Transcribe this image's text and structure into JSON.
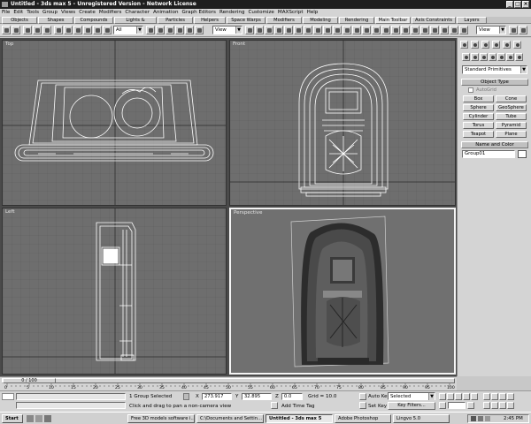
{
  "window": {
    "title": "Untitled - 3ds max 5 - Unregistered Version - Network License"
  },
  "menu": [
    "File",
    "Edit",
    "Tools",
    "Group",
    "Views",
    "Create",
    "Modifiers",
    "Character",
    "Animation",
    "Graph Editors",
    "Rendering",
    "Customize",
    "MAXScript",
    "Help"
  ],
  "tabs": [
    "Objects",
    "Shapes",
    "Compounds",
    "Lights & Cameras",
    "Particles",
    "Helpers",
    "Space Warps",
    "Modifiers",
    "Modeling",
    "Rendering",
    "Main Toolbar",
    "Axis Constraints",
    "Layers"
  ],
  "active_tab": "Main Toolbar",
  "toolbar": {
    "selection_filter": "All",
    "ref_coord": "View",
    "named_selection": "View"
  },
  "viewports": {
    "top": "Top",
    "front": "Front",
    "left": "Left",
    "perspective": "Perspective"
  },
  "command_panel": {
    "category": "Standard Primitives",
    "object_type_header": "Object Type",
    "autogrid": "AutoGrid",
    "buttons": [
      "Box",
      "Cone",
      "Sphere",
      "GeoSphere",
      "Cylinder",
      "Tube",
      "Torus",
      "Pyramid",
      "Teapot",
      "Plane"
    ],
    "name_color_header": "Name and Color",
    "object_name": "Group01"
  },
  "timeline": {
    "frame": "0 / 100",
    "ticks": [
      "0",
      "5",
      "10",
      "15",
      "20",
      "25",
      "30",
      "35",
      "40",
      "45",
      "50",
      "55",
      "60",
      "65",
      "70",
      "75",
      "80",
      "85",
      "90",
      "95",
      "100"
    ]
  },
  "status": {
    "selection": "1 Group Selected",
    "prompt": "Click and drag to pan a non-camera view",
    "x": "273.917",
    "y": "32.895",
    "z": "0.0",
    "grid": "Grid = 10.0",
    "add_time_tag": "Add Time Tag",
    "auto_key": "Auto Key",
    "set_key": "Set Key",
    "key_mode": "Selected",
    "key_filters": "Key Filters..."
  },
  "taskbar": {
    "start": "Start",
    "tasks": [
      "Free 3D models software i...",
      "C:\\Documents and Settin...",
      "Untitled - 3ds max 5",
      "Adobe Photoshop",
      "Lingvo 5.0"
    ],
    "active_task": "Untitled - 3ds max 5",
    "clock": "2:45 PM"
  }
}
